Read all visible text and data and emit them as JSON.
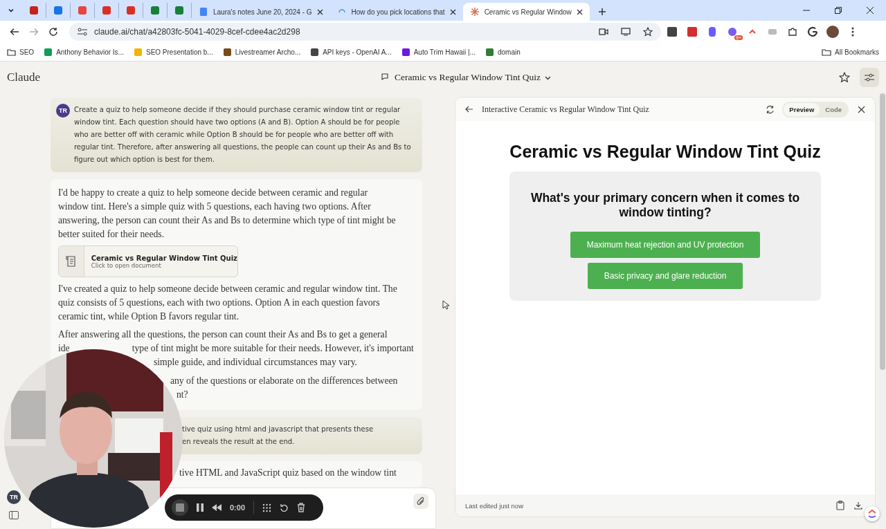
{
  "browser": {
    "tabs": [
      {
        "selected": false
      },
      {
        "selected": false
      },
      {
        "selected": false
      },
      {
        "selected": false
      },
      {
        "selected": false
      },
      {
        "selected": false
      },
      {
        "selected": false
      },
      {
        "title": "Laura's notes June 20, 2024 - G",
        "selected": false
      },
      {
        "title": "How do you pick locations that",
        "selected": false
      },
      {
        "title": "Ceramic vs Regular Window",
        "selected": true
      }
    ],
    "address": "claude.ai/chat/a42803fc-5041-4029-8cef-cdee4ac2d298",
    "extension_badge": "9+",
    "bookmarks": [
      "SEO",
      "Anthony Behavior Is...",
      "SEO Presentation b...",
      "Livestreamer Archo...",
      "API keys - OpenAI A...",
      "Auto Trim Hawaii |...",
      "domain"
    ],
    "all_bookmarks": "All Bookmarks"
  },
  "app": {
    "logo": "Claude",
    "chat_title": "Ceramic vs Regular Window Tint Quiz",
    "avatar": "TR"
  },
  "chat": {
    "prompt": {
      "avatar": "TR",
      "text": "Create a quiz to help someone decide if they should purchase ceramic window tint or regular window tint. Each question should have two options (A and B). Option A should be for people who are better off with ceramic while Option B should be for people who are better off with regular tint. Therefore, after answering all questions, the people can count up their As and Bs to figure out which option is best for them."
    },
    "reply": {
      "intro": "I'd be happy to create a quiz to help someone decide between ceramic and regular window tint. Here's a simple quiz with 5 questions, each having two options. After answering, the person can count their As and Bs to determine which type of tint might be better suited for their needs.",
      "document": {
        "title": "Ceramic vs Regular Window Tint Quiz",
        "subtitle": "Click to open document"
      },
      "paragraph": "I've created a quiz to help someone decide between ceramic and regular window tint. The quiz consists of 5 questions, each with two options. Option A in each question favors ceramic tint, while Option B favors regular tint.",
      "partial_lines": [
        [
          "After answering all the questions, the person can count their As and Bs to get a general"
        ],
        [
          "ide",
          "type of tint might be more suitable for their needs. However, it's important"
        ],
        [
          "simple guide, and individual circumstances may vary."
        ],
        [
          "any of the questions or elaborate on the differences between"
        ],
        [
          "nt?"
        ]
      ]
    },
    "prompt_2_lines": [
      "tive quiz using html and javascript that presents these",
      "en reveals the result at the end."
    ],
    "reply_2_lines": [
      "tive HTML and JavaScript quiz based on the window tint"
    ]
  },
  "recorder": {
    "time": "0:00"
  },
  "artifact_panel": {
    "title": "Interactive Ceramic vs Regular Window Tint Quiz",
    "views": [
      {
        "label": "Preview",
        "selected": true
      },
      {
        "label": "Code",
        "selected": false
      }
    ],
    "heading": "Ceramic vs Regular Window Tint Quiz",
    "question": "What's your primary concern when it comes to window tinting?",
    "options": [
      "Maximum heat rejection and UV protection",
      "Basic privacy and glare reduction"
    ],
    "footer": "Last edited just now"
  }
}
